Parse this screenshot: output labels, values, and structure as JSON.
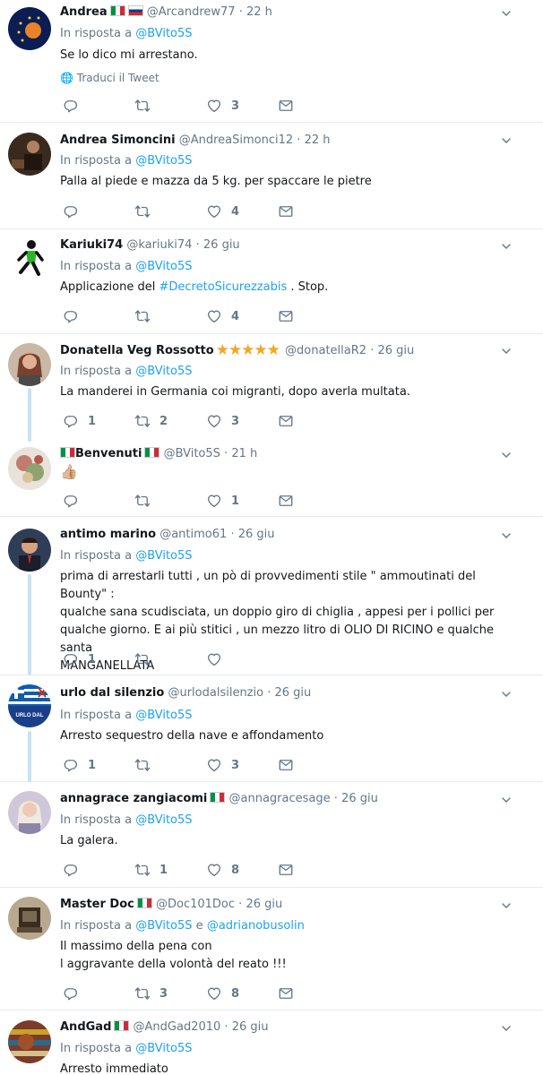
{
  "reply_prefix": "In risposta a",
  "conj": "e",
  "translate_label": "Traduci il Tweet",
  "tweets": [
    {
      "name": "Andrea",
      "handle": "@Arcandrew77",
      "time": "22 h",
      "reply_to": "@BVito5S",
      "text": "Se lo dico mi arrestano.",
      "replies": "",
      "retweets": "",
      "likes": "3"
    },
    {
      "name": "Andrea Simoncini",
      "handle": "@AndreaSimonci12",
      "time": "22 h",
      "reply_to": "@BVito5S",
      "text": "Palla al piede e mazza da 5 kg. per spaccare le pietre",
      "replies": "",
      "retweets": "",
      "likes": "4"
    },
    {
      "name": "Kariuki74",
      "handle": "@kariuki74",
      "time": "26 giu",
      "reply_to": "@BVito5S",
      "text_pre": "Applicazione del ",
      "hashtag": "#DecretoSicurezzabis",
      "text_post": " . Stop.",
      "replies": "",
      "retweets": "",
      "likes": "4"
    },
    {
      "name": "Donatella Veg Rossotto",
      "stars": "★★★★★",
      "handle": "@donatellaR2",
      "time": "26 giu",
      "reply_to": "@BVito5S",
      "text": "La manderei in Germania coi migranti, dopo averla multata.",
      "replies": "1",
      "retweets": "2",
      "likes": "3"
    },
    {
      "name": "Benvenuti",
      "handle": "@BVito5S",
      "time": "21 h",
      "text": "👍🏼",
      "replies": "",
      "retweets": "",
      "likes": "1"
    },
    {
      "name": "antimo marino",
      "handle": "@antimo61",
      "time": "26 giu",
      "reply_to": "@BVito5S",
      "text_lines": [
        "prima di arrestarli tutti ,  un pò di provvedimenti stile \" ammoutinati del Bounty\" :",
        "qualche sana scudisciata,  un doppio giro di chiglia ,  appesi per i pollici per",
        "qualche giorno. E  ai più stitici , un mezzo litro di OLIO DI RICINO e qualche santa",
        "MANGANELLATA"
      ],
      "replies": "1",
      "retweets": "",
      "likes": ""
    },
    {
      "name": "urlo dal silenzio",
      "handle": "@urlodalsilenzio",
      "time": "26 giu",
      "reply_to": "@BVito5S",
      "text": "Arresto sequestro della nave e affondamento",
      "replies": "1",
      "retweets": "",
      "likes": "3",
      "avatar_text": "URLO DAL"
    },
    {
      "name": "annagrace zangiacomi",
      "handle": "@annagracesage",
      "time": "26 giu",
      "reply_to": "@BVito5S",
      "text": "La galera.",
      "replies": "",
      "retweets": "1",
      "likes": "8"
    },
    {
      "name": "Master Doc",
      "handle": "@Doc101Doc",
      "time": "26 giu",
      "reply_to": "@BVito5S",
      "reply_to_2": "@adrianobusolin",
      "text_lines": [
        "Il massimo della pena con",
        "l aggravante della volontà del reato  !!!"
      ],
      "replies": "",
      "retweets": "3",
      "likes": "8"
    },
    {
      "name": "AndGad",
      "handle": "@AndGad2010",
      "time": "26 giu",
      "reply_to": "@BVito5S",
      "text": "Arresto immediato"
    }
  ],
  "colors": {
    "link": "#1da1f2",
    "meta": "#657786",
    "thread": "#c4e3f7",
    "star": "#f5a623"
  }
}
